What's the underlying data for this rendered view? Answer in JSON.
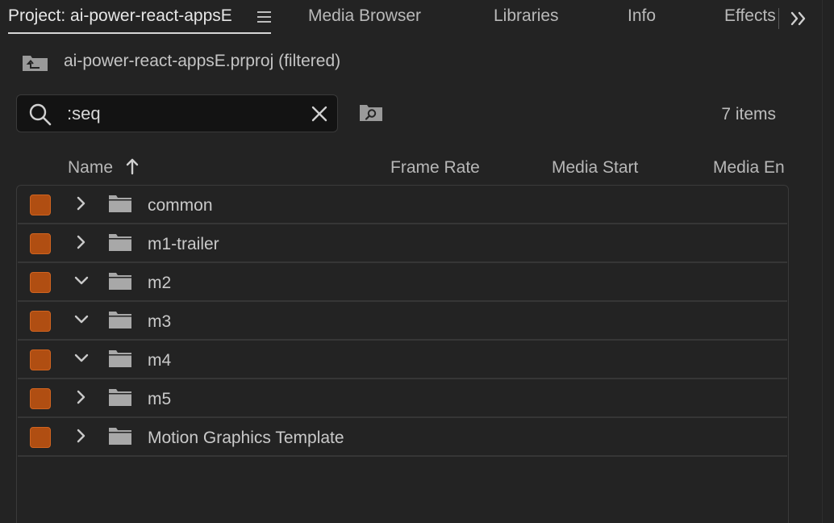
{
  "tabs": [
    {
      "label": "Project: ai-power-react-appsE",
      "active": true
    },
    {
      "label": "Media Browser"
    },
    {
      "label": "Libraries"
    },
    {
      "label": "Info"
    },
    {
      "label": "Effects"
    }
  ],
  "icons": {
    "tab_menu": "hamburger-icon",
    "overflow": "double-chevron-right-icon",
    "project": "project-bin-up-icon",
    "search": "search-icon",
    "clear": "close-icon",
    "find": "find-bin-icon",
    "sort": "arrow-up-icon",
    "folder": "folder-icon"
  },
  "project": {
    "path_label": "ai-power-react-appsE.prproj (filtered)"
  },
  "search": {
    "value": ":seq",
    "placeholder": ""
  },
  "item_count": "7 items",
  "columns": {
    "name": "Name",
    "frame_rate": "Frame Rate",
    "media_start": "Media Start",
    "media_end": "Media En"
  },
  "label_color": "#b04e12",
  "items": [
    {
      "name": "common",
      "expanded": false
    },
    {
      "name": "m1-trailer",
      "expanded": false
    },
    {
      "name": "m2",
      "expanded": true
    },
    {
      "name": "m3",
      "expanded": true
    },
    {
      "name": "m4",
      "expanded": true
    },
    {
      "name": "m5",
      "expanded": false
    },
    {
      "name": "Motion Graphics Template",
      "expanded": false
    }
  ]
}
